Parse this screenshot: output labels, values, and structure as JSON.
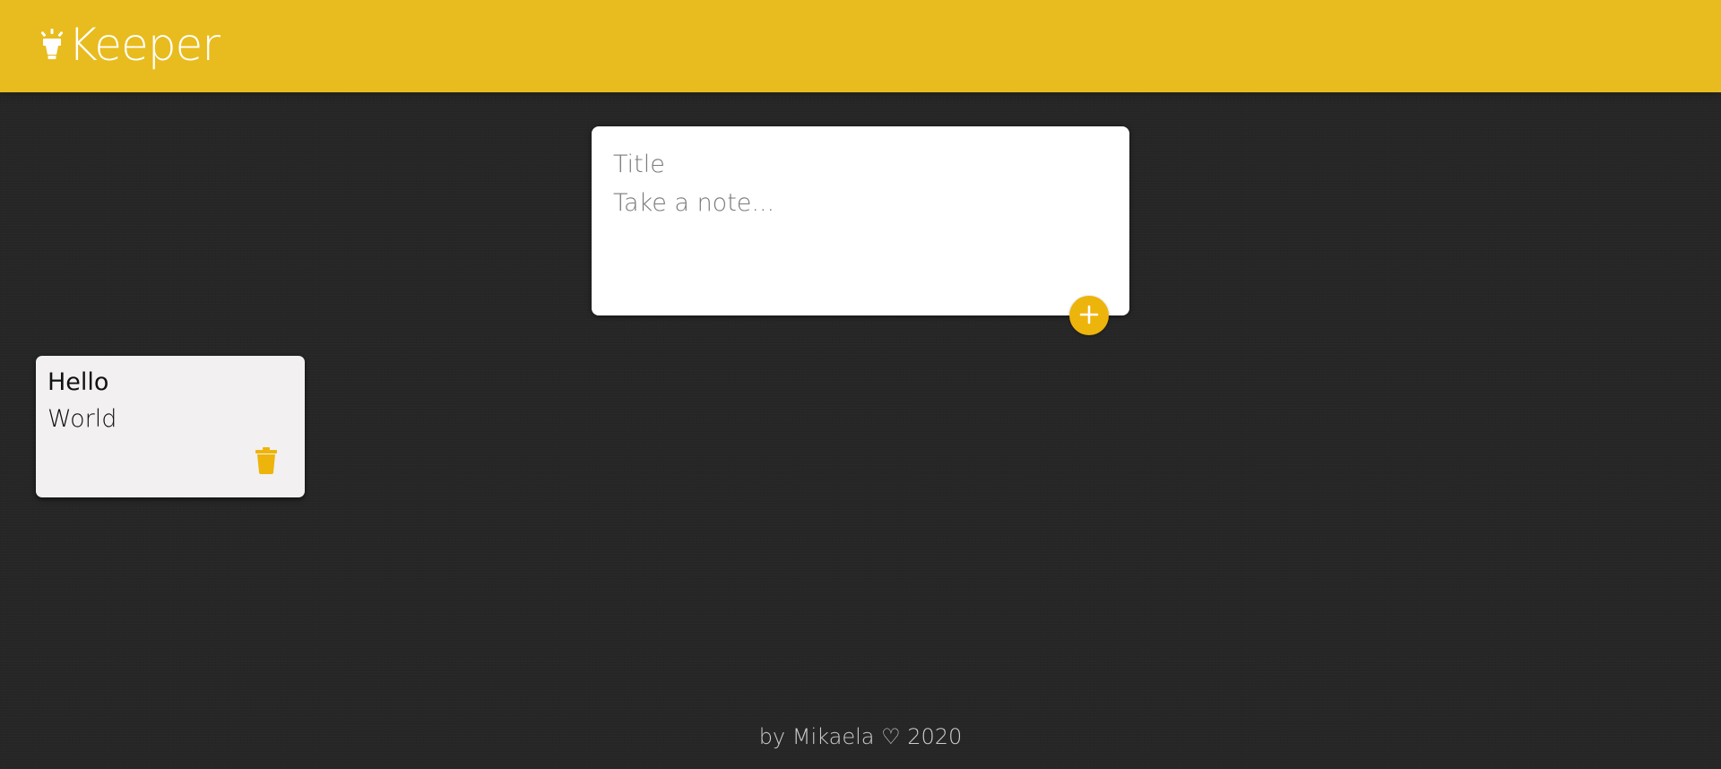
{
  "header": {
    "app_name": "Keeper",
    "icon": "lightbulb-icon"
  },
  "create_area": {
    "title_placeholder": "Title",
    "content_placeholder": "Take a note...",
    "add_icon": "plus-icon"
  },
  "notes": [
    {
      "title": "Hello",
      "content": "World",
      "delete_icon": "trash-icon"
    }
  ],
  "footer": {
    "text": "by Mikaela ♡ 2020"
  },
  "colors": {
    "header_bg": "#E8BC1E",
    "accent": "#EDB40C",
    "background": "#262626",
    "note_bg": "#F2F0F0"
  }
}
